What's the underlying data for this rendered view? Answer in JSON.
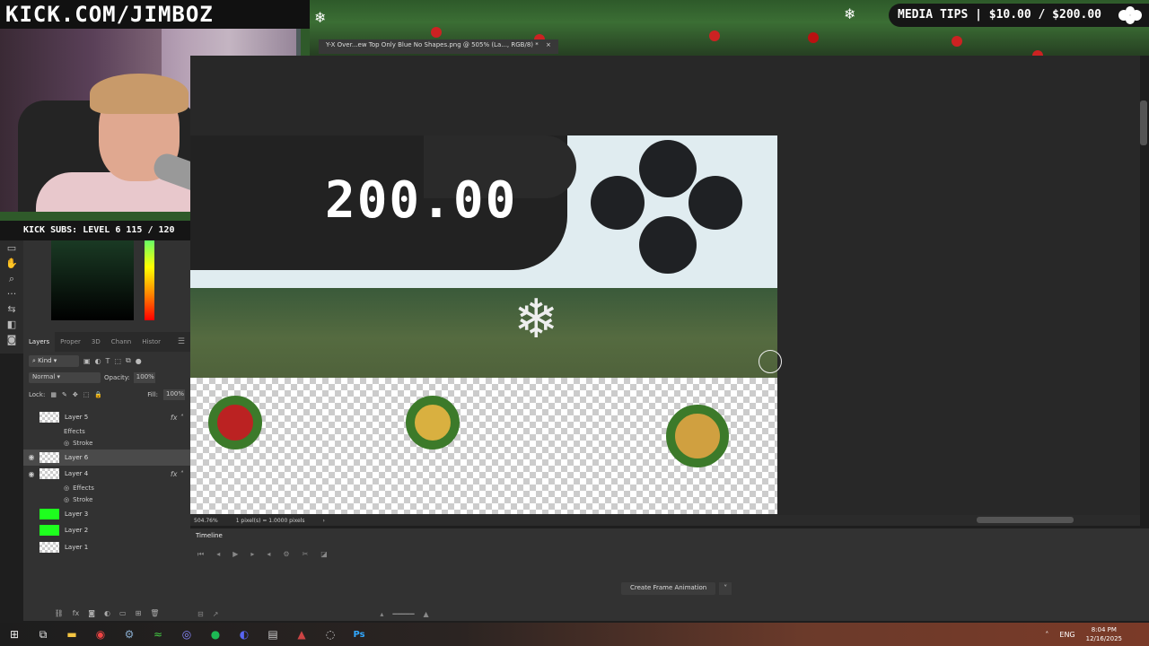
{
  "overlay": {
    "kick_url": "KICK.COM/JIMBOZ",
    "media_tips": "MEDIA TIPS | $10.00 / $200.00",
    "kick_subs": "KICK SUBS: LEVEL 6 115 / 120"
  },
  "document": {
    "tab_title": "Y-X Over...ew Top Only Blue No Shapes.png @ 505% (La..., RGB/8) *",
    "tab_close": "×",
    "canvas_amount": "200.00"
  },
  "status": {
    "zoom": "504.76%",
    "info": "1 pixel(s) = 1.0000 pixels"
  },
  "layers_panel": {
    "tabs": [
      "Layers",
      "Proper",
      "3D",
      "Chann",
      "Histor"
    ],
    "kind_label": "Kind",
    "blend_mode": "Normal",
    "opacity_label": "Opacity:",
    "opacity_value": "100%",
    "lock_label": "Lock:",
    "fill_label": "Fill:",
    "fill_value": "100%",
    "layers": [
      {
        "name": "Layer 5",
        "visible": false,
        "fx": true,
        "effects": [
          "Effects",
          "Stroke"
        ]
      },
      {
        "name": "Layer 6",
        "visible": true,
        "selected": true
      },
      {
        "name": "Layer 4",
        "visible": true,
        "fx": true,
        "effects": [
          "Effects",
          "Stroke"
        ]
      },
      {
        "name": "Layer 3",
        "visible": false,
        "thumb": "green"
      },
      {
        "name": "Layer 2",
        "visible": false,
        "thumb": "green"
      },
      {
        "name": "Layer 1",
        "visible": false
      }
    ]
  },
  "timeline": {
    "title": "Timeline",
    "create_button": "Create Frame Animation"
  },
  "taskbar": {
    "lang": "ENG",
    "time": "8:04 PM",
    "date": "12/16/2025"
  }
}
